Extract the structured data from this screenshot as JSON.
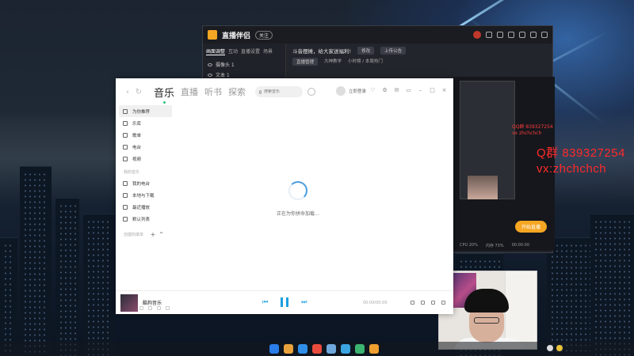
{
  "stream_app": {
    "title": "直播伴侣",
    "version_badge": "关注",
    "tabs": [
      "画面调整",
      "互动",
      "直播设置",
      "场景"
    ],
    "sources": [
      "摄像头 1",
      "文本 1"
    ],
    "room_title": "斗音摆摊，给大家送福利!",
    "edit_chip": "修改",
    "upload_chip": "上传公告",
    "sub_info": [
      "直播管理",
      "大神教学",
      "小时榜 / 本周热门"
    ],
    "start_label": "开始直播",
    "bottom_stats": [
      "CPU 20%",
      "内存 73%",
      "00:00:00"
    ],
    "preview_qq_lines": [
      "QQ群 839327254",
      "vx zhchchch"
    ]
  },
  "overlay": {
    "qq_line": "Q群 839327254",
    "vx_line": "vx:zhchchch",
    "color": "#ff2a2a"
  },
  "music_app": {
    "tabs": [
      {
        "label": "音乐",
        "active": true
      },
      {
        "label": "直播"
      },
      {
        "label": "听书"
      },
      {
        "label": "探索"
      }
    ],
    "search_placeholder": "搜索音乐",
    "login_label": "立即登录",
    "sidebar": {
      "main_items": [
        "为你推荐",
        "乐库",
        "歌单",
        "电台",
        "视频"
      ],
      "my_music_header": "我的音乐",
      "my_items": [
        "我的电台",
        "本地与下载",
        "最近播放",
        "默认列表"
      ],
      "playlist_header": "创建的歌单"
    },
    "loading_text": "正在为你拼命加载…",
    "player": {
      "song": "酷狗音乐",
      "time": "00:00/00:00"
    },
    "accent": "#1a9fe0"
  }
}
